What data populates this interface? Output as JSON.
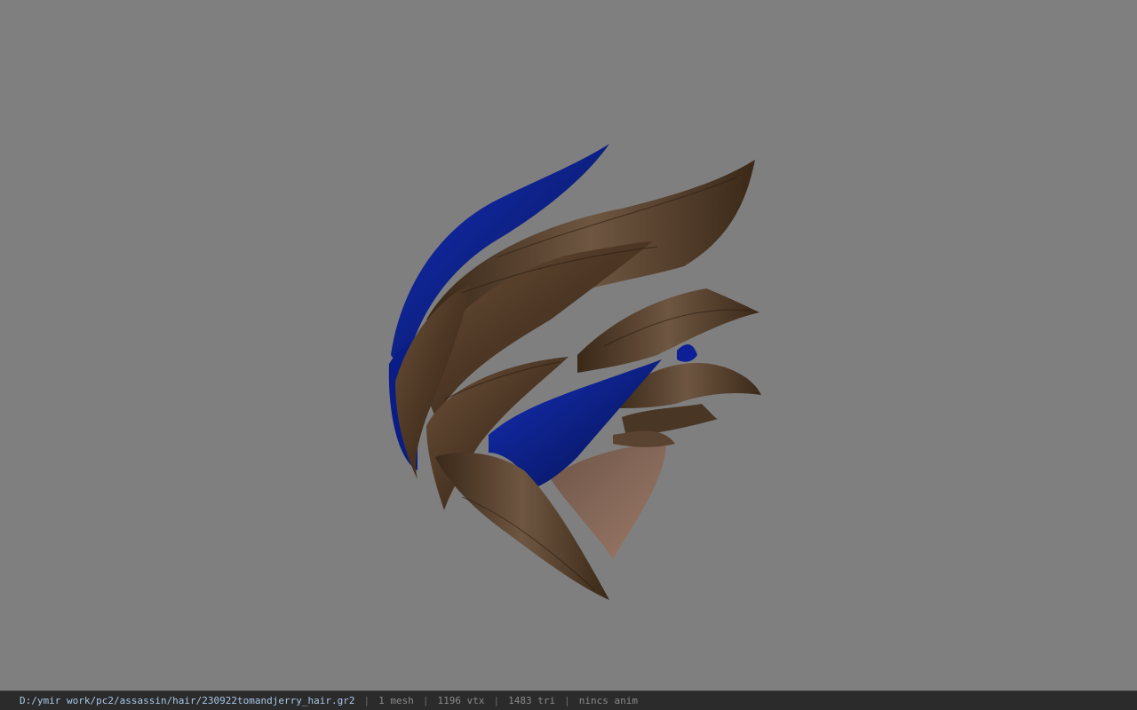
{
  "status": {
    "path": "D:/ymir work/pc2/assassin/hair/230922tomandjerry_hair.gr2",
    "separator": "|",
    "meshes": "1 mesh",
    "vertices": "1196 vtx",
    "triangles": "1483 tri",
    "animation": "nincs anim"
  },
  "colors": {
    "background": "#7f7f7f",
    "hair_brown": "#5a4330",
    "hair_blue": "#0a1a8a"
  }
}
